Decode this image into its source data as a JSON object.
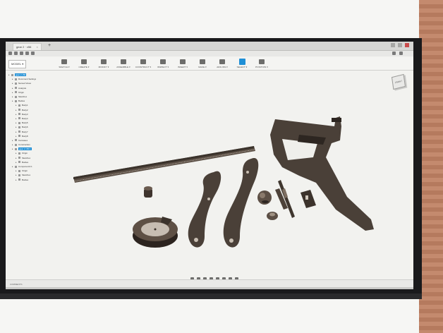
{
  "window": {
    "tab_title": "gear 2 · v56",
    "tab_close": "×",
    "new_tab": "+"
  },
  "ribbon": {
    "workspace": "MODEL ▾",
    "groups": [
      {
        "label": "SKETCH ▾",
        "icon": "sketch-icon"
      },
      {
        "label": "CREATE ▾",
        "icon": "create-icon"
      },
      {
        "label": "MODIFY ▾",
        "icon": "modify-icon"
      },
      {
        "label": "ASSEMBLE ▾",
        "icon": "assemble-icon"
      },
      {
        "label": "CONSTRUCT ▾",
        "icon": "construct-icon"
      },
      {
        "label": "INSPECT ▾",
        "icon": "inspect-icon"
      },
      {
        "label": "INSERT ▾",
        "icon": "insert-icon"
      },
      {
        "label": "MAKE ▾",
        "icon": "make-icon"
      },
      {
        "label": "ADD-INS ▾",
        "icon": "addins-icon"
      },
      {
        "label": "SELECT ▾",
        "icon": "select-icon",
        "active": true
      },
      {
        "label": "POSITION ▾",
        "icon": "position-icon"
      }
    ]
  },
  "viewcube": {
    "face_label": "FRONT"
  },
  "browser": {
    "items": [
      {
        "label": "gear 2 v56",
        "level": 0,
        "highlight": true
      },
      {
        "label": "Document Settings",
        "level": 1
      },
      {
        "label": "Named Views",
        "level": 1
      },
      {
        "label": "Analysis",
        "level": 1
      },
      {
        "label": "Origin",
        "level": 1
      },
      {
        "label": "Sketches",
        "level": 1
      },
      {
        "label": "Bodies",
        "level": 1
      },
      {
        "label": "Body1",
        "level": 2
      },
      {
        "label": "Body2",
        "level": 2
      },
      {
        "label": "Body3",
        "level": 2
      },
      {
        "label": "Body4",
        "level": 2
      },
      {
        "label": "Body5",
        "level": 2
      },
      {
        "label": "Body6",
        "level": 2
      },
      {
        "label": "Body7",
        "level": 2
      },
      {
        "label": "Body8",
        "level": 2
      },
      {
        "label": "Canvases",
        "level": 1
      },
      {
        "label": "Construction",
        "level": 1
      },
      {
        "label": "gear 2 v56:1",
        "level": 1,
        "highlight": true
      },
      {
        "label": "Origin",
        "level": 2
      },
      {
        "label": "Sketches",
        "level": 2
      },
      {
        "label": "Bodies",
        "level": 2
      },
      {
        "label": "Component1:1",
        "level": 1
      },
      {
        "label": "Origin",
        "level": 2
      },
      {
        "label": "Sketches",
        "level": 2
      },
      {
        "label": "Bodies",
        "level": 2
      }
    ]
  },
  "timeline": {
    "label": "COMMENTS"
  },
  "colors": {
    "part_fill": "#4a4038",
    "part_dark": "#2f2822",
    "part_light": "#7a6a5c",
    "accent_blue": "#1f8fd6"
  }
}
